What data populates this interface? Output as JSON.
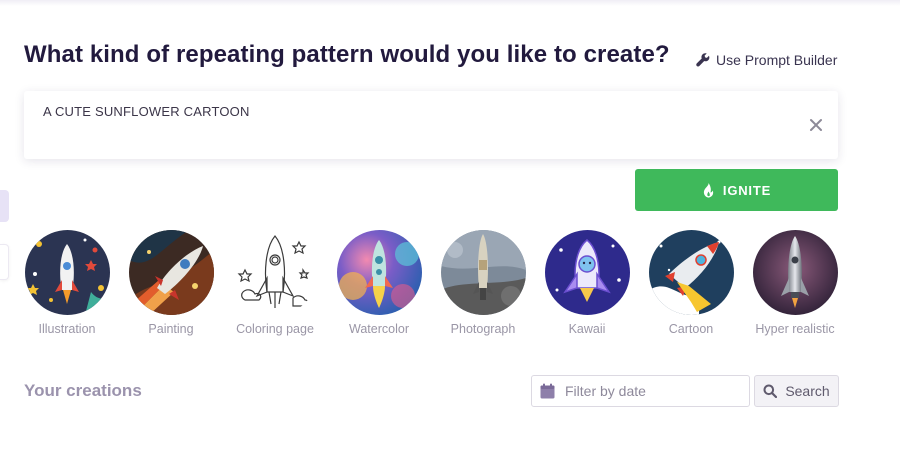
{
  "header": {
    "title": "What kind of repeating pattern would you like to create?",
    "prompt_builder_label": "Use Prompt Builder",
    "prompt_builder_icon": "wrench-icon"
  },
  "prompt": {
    "value": "A CUTE SUNFLOWER CARTOON",
    "clear_icon": "close-icon"
  },
  "ignite_button": {
    "label": "IGNITE",
    "icon": "flame-icon",
    "color": "#3fb95b"
  },
  "styles": [
    {
      "label": "Illustration"
    },
    {
      "label": "Painting"
    },
    {
      "label": "Coloring page"
    },
    {
      "label": "Watercolor"
    },
    {
      "label": "Photograph"
    },
    {
      "label": "Kawaii"
    },
    {
      "label": "Cartoon"
    },
    {
      "label": "Hyper realistic"
    }
  ],
  "creations": {
    "title": "Your creations",
    "filter_placeholder": "Filter by date",
    "filter_icon": "calendar-icon",
    "search_label": "Search",
    "search_icon": "search-icon"
  }
}
